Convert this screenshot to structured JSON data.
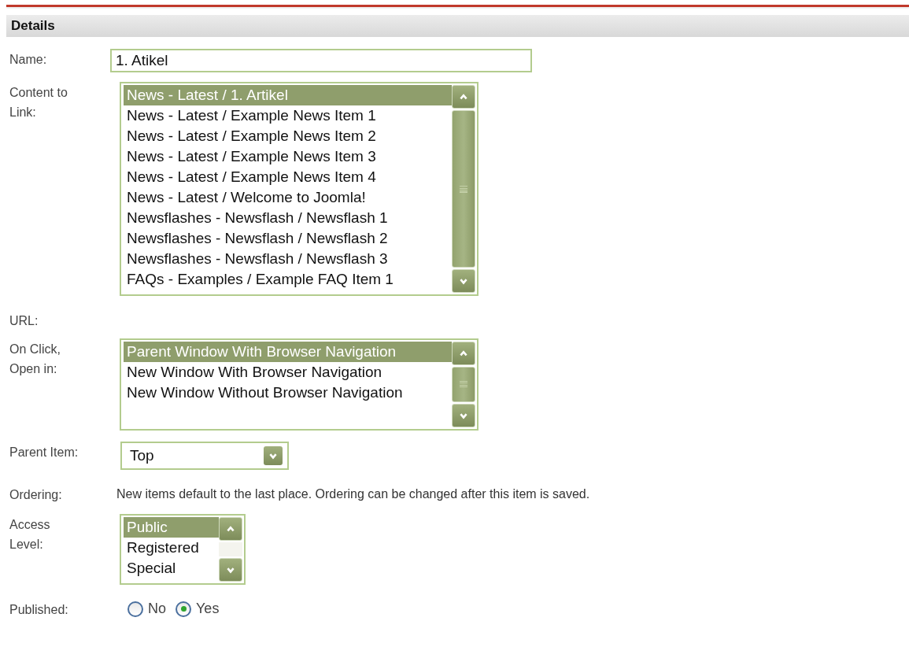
{
  "section": {
    "title": "Details"
  },
  "fields": [
    {
      "kind": "text",
      "label": "Name:",
      "value": "1. Atikel"
    },
    {
      "kind": "listbox",
      "label": "Content to Link:",
      "options": [
        {
          "text": "News - Latest / 1. Artikel",
          "selected": true
        },
        {
          "text": "News - Latest / Example News Item 1",
          "selected": false
        },
        {
          "text": "News - Latest / Example News Item 2",
          "selected": false
        },
        {
          "text": "News - Latest / Example News Item 3",
          "selected": false
        },
        {
          "text": "News - Latest / Example News Item 4",
          "selected": false
        },
        {
          "text": "News - Latest / Welcome to Joomla!",
          "selected": false
        },
        {
          "text": "Newsflashes - Newsflash / Newsflash 1",
          "selected": false
        },
        {
          "text": "Newsflashes - Newsflash / Newsflash 2",
          "selected": false
        },
        {
          "text": "Newsflashes - Newsflash / Newsflash 3",
          "selected": false
        },
        {
          "text": "FAQs - Examples / Example FAQ Item 1",
          "selected": false
        }
      ]
    },
    {
      "kind": "plain",
      "label": "URL:"
    },
    {
      "kind": "listbox",
      "label": "On Click, Open in:",
      "options": [
        {
          "text": "Parent Window With Browser Navigation",
          "selected": true
        },
        {
          "text": "New Window With Browser Navigation",
          "selected": false
        },
        {
          "text": "New Window Without Browser Navigation",
          "selected": false
        }
      ]
    },
    {
      "kind": "dropdown",
      "label": "Parent Item:",
      "value": "Top"
    },
    {
      "kind": "note",
      "label": "Ordering:",
      "text": "New items default to the last place. Ordering can be changed after this item is saved."
    },
    {
      "kind": "listbox",
      "label": "Access Level:",
      "options": [
        {
          "text": "Public",
          "selected": true
        },
        {
          "text": "Registered",
          "selected": false
        },
        {
          "text": "Special",
          "selected": false
        }
      ]
    },
    {
      "kind": "radio",
      "label": "Published:",
      "options": [
        {
          "text": "No",
          "selected": false
        },
        {
          "text": "Yes",
          "selected": true
        }
      ]
    }
  ]
}
